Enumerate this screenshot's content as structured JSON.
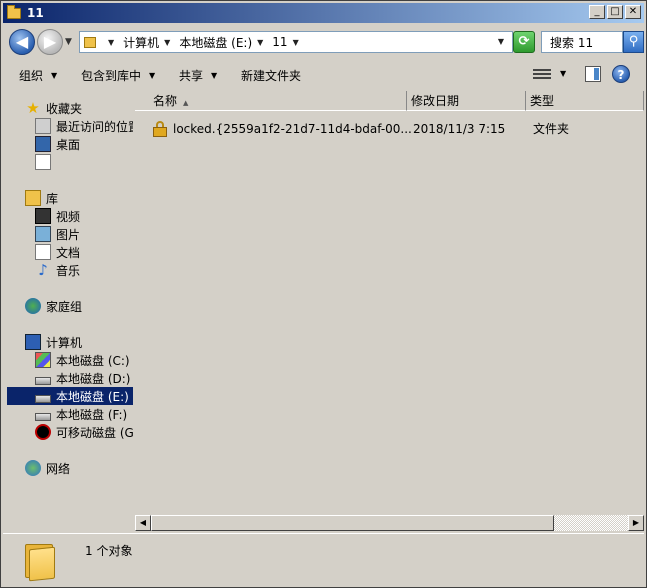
{
  "window": {
    "title": "11",
    "minimize": "_",
    "maximize": "□",
    "close": "✕"
  },
  "address": {
    "crumbs": [
      "计算机",
      "本地磁盘 (E:)",
      "11"
    ],
    "search_placeholder": "搜索 11"
  },
  "toolbar": {
    "organize": "组织",
    "include_in_library": "包含到库中",
    "share": "共享",
    "new_folder": "新建文件夹"
  },
  "nav": {
    "favorites": "收藏夹",
    "recent": "最近访问的位置",
    "desktop": "桌面",
    "libraries": "库",
    "videos": "视频",
    "pictures": "图片",
    "documents": "文档",
    "music": "音乐",
    "homegroup": "家庭组",
    "computer": "计算机",
    "drive_c": "本地磁盘 (C:)",
    "drive_d": "本地磁盘 (D:)",
    "drive_e": "本地磁盘 (E:)",
    "drive_f": "本地磁盘 (F:)",
    "removable": "可移动磁盘 (G:)",
    "network": "网络"
  },
  "columns": {
    "name": "名称",
    "modified": "修改日期",
    "type": "类型"
  },
  "files": [
    {
      "name": "locked.{2559a1f2-21d7-11d4-bdaf-00...",
      "modified": "2018/11/3 7:15",
      "type": "文件夹",
      "icon": "lock-icon"
    }
  ],
  "details": {
    "count": "1 个对象"
  }
}
